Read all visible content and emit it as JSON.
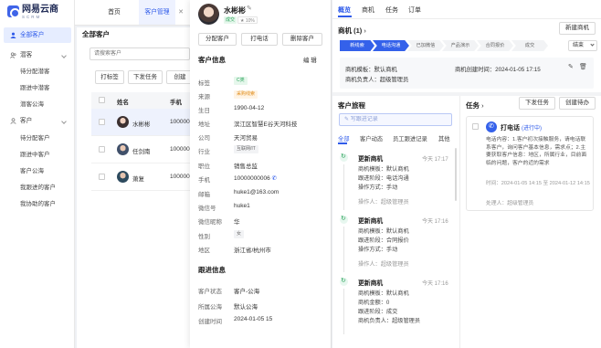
{
  "brand": {
    "name": "网易云商",
    "sub": "SCRM"
  },
  "sidebar": {
    "top_item": "全部客户",
    "groups": [
      {
        "label": "潜客",
        "items": [
          "待分配潜客",
          "跟进中潜客",
          "潜客公海"
        ]
      },
      {
        "label": "客户",
        "items": [
          "待分配客户",
          "跟进中客户",
          "客户公海"
        ]
      }
    ],
    "tail": [
      "我跟进的客户",
      "我协助的客户"
    ]
  },
  "topbar": {
    "tabs": [
      "首页",
      "客户管理"
    ],
    "close": "✕"
  },
  "list": {
    "title": "全部客户",
    "search_placeholder": "请搜索客户",
    "buttons": [
      "打标签",
      "下发任务",
      "创建"
    ],
    "columns": [
      "姓名",
      "手机"
    ],
    "rows": [
      {
        "name": "水彬彬",
        "phone": "100000"
      },
      {
        "name": "任剑南",
        "phone": "100000"
      },
      {
        "name": "萧复",
        "phone": "100000"
      }
    ]
  },
  "drawer": {
    "name": "水彬彬",
    "status_tag": "成交",
    "progress": "10%",
    "actions": [
      "分配客户",
      "打电话",
      "删除客户"
    ],
    "info_title": "客户信息",
    "edit": "编 辑",
    "fields": [
      {
        "label": "标签",
        "value": "C类",
        "kind": "tag-green"
      },
      {
        "label": "来源",
        "value": "采购线索",
        "kind": "tag-orange"
      },
      {
        "label": "生日",
        "value": "1990-04-12"
      },
      {
        "label": "地址",
        "value": "滨江区智慧E谷天河科技"
      },
      {
        "label": "公司",
        "value": "天河贸易"
      },
      {
        "label": "行业",
        "value": "互联网/IT",
        "kind": "tag-grey"
      },
      {
        "label": "职位",
        "value": "销售总监"
      },
      {
        "label": "手机",
        "value": "10000000006"
      },
      {
        "label": "邮箱",
        "value": "huke1@163.com"
      },
      {
        "label": "微信号",
        "value": "huke1"
      },
      {
        "label": "微信昵称",
        "value": "华"
      },
      {
        "label": "性别",
        "value": "女",
        "kind": "tag-grey"
      },
      {
        "label": "地区",
        "value": "浙江省/杭州市"
      }
    ],
    "follow_title": "跟进信息",
    "follow_fields": [
      {
        "label": "客户状态",
        "value": "客户-公海"
      },
      {
        "label": "所属公海",
        "value": "默认公海"
      },
      {
        "label": "创建时间",
        "value": "2024-01-05 15"
      }
    ]
  },
  "main": {
    "tabs": [
      "概览",
      "商机",
      "任务",
      "订单"
    ],
    "opportunity_title": "商机 (1)",
    "new_opportunity": "新建商机",
    "stages": [
      "新线索",
      "电话沟通",
      "已加微信",
      "产品演示",
      "合同报价",
      "成交"
    ],
    "stages_done": 2,
    "end_label": "结束",
    "opp_info": {
      "template": "商机模板：默认商机",
      "owner": "商机负责人：超级管理员",
      "created": "商机创建时间：2024-01-05 17:15"
    },
    "journey": {
      "title": "客户旅程",
      "write_placeholder": "写跟进记录",
      "filters": [
        "全部",
        "客户动态",
        "员工跟进记录",
        "其他"
      ],
      "entries": [
        {
          "title": "更新商机",
          "time": "今天 17:17",
          "lines": [
            "商机模板：默认商机",
            "跟进阶段：电话沟通",
            "操作方式：手动"
          ],
          "operator": "操作人：超级管理员"
        },
        {
          "title": "更新商机",
          "time": "今天 17:16",
          "lines": [
            "商机模板：默认商机",
            "跟进阶段：合同报价",
            "操作方式：手动"
          ],
          "operator": "操作人：超级管理员"
        },
        {
          "title": "更新商机",
          "time": "今天 17:16",
          "lines": [
            "商机模板：默认商机",
            "商机金额：0",
            "跟进阶段：成交",
            "商机负责人：超级管理员"
          ],
          "operator": ""
        }
      ]
    },
    "tasks": {
      "title": "任务",
      "count_arrow": "›",
      "issue_btn": "下发任务",
      "create_btn": "创建待办",
      "card": {
        "title": "打电话",
        "status": "(进行中)",
        "content": "电话内容：1.客户初次接触服务，请电话联系客户，询问客户基本信息，需求点；2.主要获取客户信息：地区，所属行业，目前面临的问题，客户的近的需求",
        "time": "时间：2024-01-05 14:15 至 2024-01-12 14:15",
        "handler": "处理人：超级管理员"
      }
    }
  },
  "colors": {
    "accent": "#2f5bea",
    "green": "#2aa35a",
    "orange": "#e08a14"
  }
}
